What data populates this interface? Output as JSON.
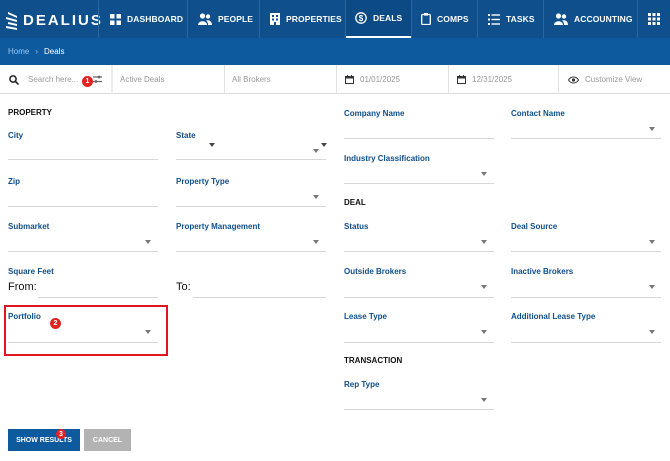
{
  "brand": {
    "name": "DEALIUS"
  },
  "nav": {
    "dashboard": "DASHBOARD",
    "people": "PEOPLE",
    "properties": "PROPERTIES",
    "deals": "DEALS",
    "comps": "COMPS",
    "tasks": "TASKS",
    "accounting": "ACCOUNTING"
  },
  "breadcrumb": {
    "home": "Home",
    "current": "Deals"
  },
  "filters": {
    "search_placeholder": "Search here...",
    "deal_status": "Active Deals",
    "brokers": "All Brokers",
    "date_from": "01/01/2025",
    "date_to": "12/31/2025",
    "customize": "Customize View"
  },
  "property": {
    "heading": "PROPERTY",
    "city": "City",
    "state": "State",
    "zip": "Zip",
    "property_type": "Property Type",
    "submarket": "Submarket",
    "property_management": "Property Management",
    "square_feet": "Square Feet",
    "from": "From:",
    "to": "To:",
    "portfolio": "Portfolio"
  },
  "company": {
    "company_name": "Company Name",
    "contact_name": "Contact Name",
    "industry_classification": "Industry Classification"
  },
  "deal": {
    "heading": "DEAL",
    "status": "Status",
    "deal_source": "Deal Source",
    "outside_brokers": "Outside Brokers",
    "inactive_brokers": "Inactive Brokers",
    "lease_type": "Lease Type",
    "additional_lease_type": "Additional Lease Type"
  },
  "transaction": {
    "heading": "TRANSACTION",
    "rep_type": "Rep Type"
  },
  "buttons": {
    "show_results": "SHOW RESULTS",
    "cancel": "CANCEL"
  },
  "annotations": {
    "step1": "1",
    "step2": "2",
    "step3": "3"
  },
  "colors": {
    "nav": "#0e4f8c",
    "breadcrumb": "#0e5a9e",
    "label": "#0e4f8c",
    "highlight": "#e0161c",
    "badge": "#e02424",
    "primary_button": "#0e5a9e",
    "cancel_button": "#b3b3b3"
  }
}
